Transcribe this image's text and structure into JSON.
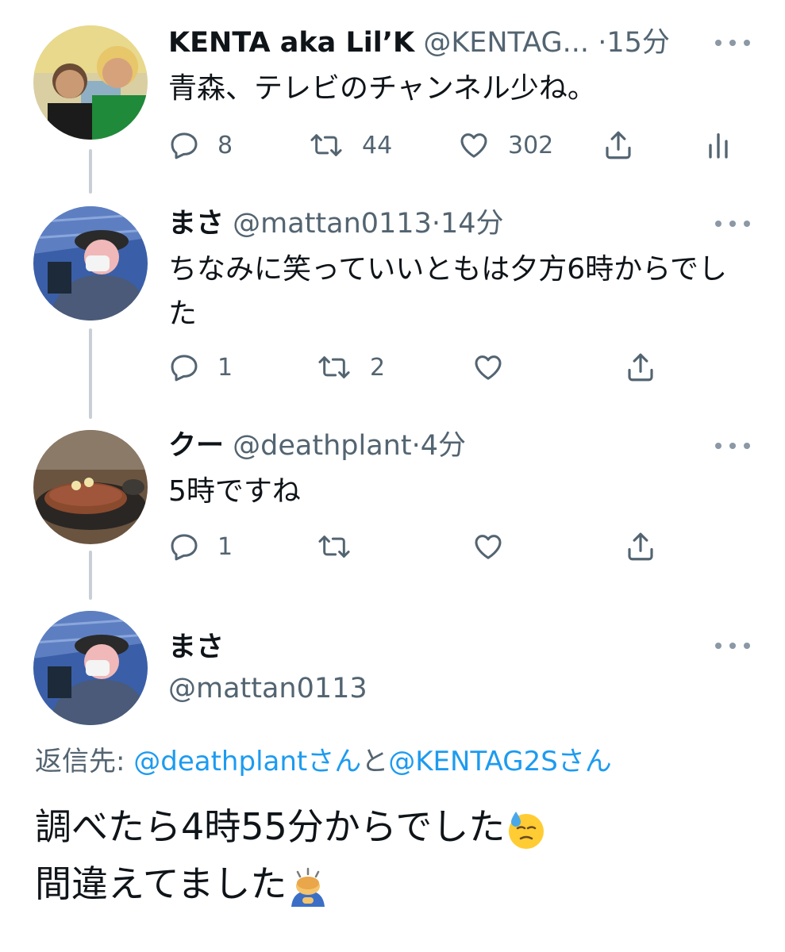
{
  "tweets": [
    {
      "name": "KENTA aka Lil’K",
      "handle": "@KENTAG...",
      "dot": "·",
      "time": "15分",
      "text": "青森、テレビのチャンネル少ね。",
      "counts": {
        "reply": "8",
        "retweet": "44",
        "like": "302"
      },
      "show_analytics": true
    },
    {
      "name": "まさ",
      "handle": "@mattan0113",
      "dot": "·",
      "time": "14分",
      "text": "ちなみに笑っていいともは夕方6時からでした",
      "counts": {
        "reply": "1",
        "retweet": "2",
        "like": ""
      },
      "show_analytics": false
    },
    {
      "name": "クー",
      "handle": "@deathplant",
      "dot": "·",
      "time": "4分",
      "text": "5時ですね",
      "counts": {
        "reply": "1",
        "retweet": "",
        "like": ""
      },
      "show_analytics": false
    }
  ],
  "main_tweet": {
    "name": "まさ",
    "handle": "@mattan0113",
    "reply_prefix": "返信先: ",
    "reply_link_1": "@deathplantさん",
    "reply_joiner": "と",
    "reply_link_2": "@KENTAG2Sさん",
    "line1": "調べたら4時55分からでした",
    "line2": "間違えてました"
  },
  "icons": {
    "reply": "reply-bubble-icon",
    "retweet": "retweet-icon",
    "like": "heart-icon",
    "share": "share-upload-icon",
    "analytics": "analytics-bars-icon",
    "more": "more-dots-icon",
    "emoji_1": "downcast-face-with-sweat-emoji",
    "emoji_2": "person-bowing-emoji"
  },
  "colors": {
    "link": "#1d9bf0",
    "secondary_text": "#536471",
    "thread_line": "#c9cfd6"
  }
}
